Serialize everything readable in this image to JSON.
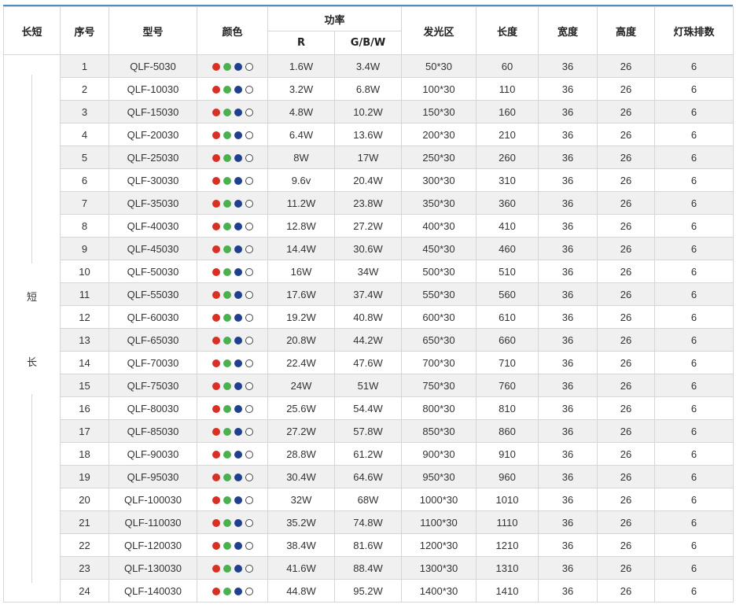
{
  "headers": {
    "length_type": "长短",
    "no": "序号",
    "model": "型号",
    "color": "颜色",
    "power": "功率",
    "power_r": "R",
    "power_gbw": "G/B/W",
    "emitting_area": "发光区",
    "length": "长度",
    "width": "宽度",
    "height": "高度",
    "led_rows": "灯珠排数"
  },
  "length_type_chars": [
    "短",
    "长"
  ],
  "color_dots": [
    "red",
    "green",
    "blue",
    "white"
  ],
  "rows": [
    {
      "no": "1",
      "model": "QLF-5030",
      "r": "1.6W",
      "gbw": "3.4W",
      "area": "50*30",
      "length": "60",
      "width": "36",
      "height": "26",
      "rows": "6"
    },
    {
      "no": "2",
      "model": "QLF-10030",
      "r": "3.2W",
      "gbw": "6.8W",
      "area": "100*30",
      "length": "110",
      "width": "36",
      "height": "26",
      "rows": "6"
    },
    {
      "no": "3",
      "model": "QLF-15030",
      "r": "4.8W",
      "gbw": "10.2W",
      "area": "150*30",
      "length": "160",
      "width": "36",
      "height": "26",
      "rows": "6"
    },
    {
      "no": "4",
      "model": "QLF-20030",
      "r": "6.4W",
      "gbw": "13.6W",
      "area": "200*30",
      "length": "210",
      "width": "36",
      "height": "26",
      "rows": "6"
    },
    {
      "no": "5",
      "model": "QLF-25030",
      "r": "8W",
      "gbw": "17W",
      "area": "250*30",
      "length": "260",
      "width": "36",
      "height": "26",
      "rows": "6"
    },
    {
      "no": "6",
      "model": "QLF-30030",
      "r": "9.6v",
      "gbw": "20.4W",
      "area": "300*30",
      "length": "310",
      "width": "36",
      "height": "26",
      "rows": "6"
    },
    {
      "no": "7",
      "model": "QLF-35030",
      "r": "11.2W",
      "gbw": "23.8W",
      "area": "350*30",
      "length": "360",
      "width": "36",
      "height": "26",
      "rows": "6"
    },
    {
      "no": "8",
      "model": "QLF-40030",
      "r": "12.8W",
      "gbw": "27.2W",
      "area": "400*30",
      "length": "410",
      "width": "36",
      "height": "26",
      "rows": "6"
    },
    {
      "no": "9",
      "model": "QLF-45030",
      "r": "14.4W",
      "gbw": "30.6W",
      "area": "450*30",
      "length": "460",
      "width": "36",
      "height": "26",
      "rows": "6"
    },
    {
      "no": "10",
      "model": "QLF-50030",
      "r": "16W",
      "gbw": "34W",
      "area": "500*30",
      "length": "510",
      "width": "36",
      "height": "26",
      "rows": "6"
    },
    {
      "no": "11",
      "model": "QLF-55030",
      "r": "17.6W",
      "gbw": "37.4W",
      "area": "550*30",
      "length": "560",
      "width": "36",
      "height": "26",
      "rows": "6"
    },
    {
      "no": "12",
      "model": "QLF-60030",
      "r": "19.2W",
      "gbw": "40.8W",
      "area": "600*30",
      "length": "610",
      "width": "36",
      "height": "26",
      "rows": "6"
    },
    {
      "no": "13",
      "model": "QLF-65030",
      "r": "20.8W",
      "gbw": "44.2W",
      "area": "650*30",
      "length": "660",
      "width": "36",
      "height": "26",
      "rows": "6"
    },
    {
      "no": "14",
      "model": "QLF-70030",
      "r": "22.4W",
      "gbw": "47.6W",
      "area": "700*30",
      "length": "710",
      "width": "36",
      "height": "26",
      "rows": "6"
    },
    {
      "no": "15",
      "model": "QLF-75030",
      "r": "24W",
      "gbw": "51W",
      "area": "750*30",
      "length": "760",
      "width": "36",
      "height": "26",
      "rows": "6"
    },
    {
      "no": "16",
      "model": "QLF-80030",
      "r": "25.6W",
      "gbw": "54.4W",
      "area": "800*30",
      "length": "810",
      "width": "36",
      "height": "26",
      "rows": "6"
    },
    {
      "no": "17",
      "model": "QLF-85030",
      "r": "27.2W",
      "gbw": "57.8W",
      "area": "850*30",
      "length": "860",
      "width": "36",
      "height": "26",
      "rows": "6"
    },
    {
      "no": "18",
      "model": "QLF-90030",
      "r": "28.8W",
      "gbw": "61.2W",
      "area": "900*30",
      "length": "910",
      "width": "36",
      "height": "26",
      "rows": "6"
    },
    {
      "no": "19",
      "model": "QLF-95030",
      "r": "30.4W",
      "gbw": "64.6W",
      "area": "950*30",
      "length": "960",
      "width": "36",
      "height": "26",
      "rows": "6"
    },
    {
      "no": "20",
      "model": "QLF-100030",
      "r": "32W",
      "gbw": "68W",
      "area": "1000*30",
      "length": "1010",
      "width": "36",
      "height": "26",
      "rows": "6"
    },
    {
      "no": "21",
      "model": "QLF-110030",
      "r": "35.2W",
      "gbw": "74.8W",
      "area": "1100*30",
      "length": "1110",
      "width": "36",
      "height": "26",
      "rows": "6"
    },
    {
      "no": "22",
      "model": "QLF-120030",
      "r": "38.4W",
      "gbw": "81.6W",
      "area": "1200*30",
      "length": "1210",
      "width": "36",
      "height": "26",
      "rows": "6"
    },
    {
      "no": "23",
      "model": "QLF-130030",
      "r": "41.6W",
      "gbw": "88.4W",
      "area": "1300*30",
      "length": "1310",
      "width": "36",
      "height": "26",
      "rows": "6"
    },
    {
      "no": "24",
      "model": "QLF-140030",
      "r": "44.8W",
      "gbw": "95.2W",
      "area": "1400*30",
      "length": "1410",
      "width": "36",
      "height": "26",
      "rows": "6"
    }
  ]
}
